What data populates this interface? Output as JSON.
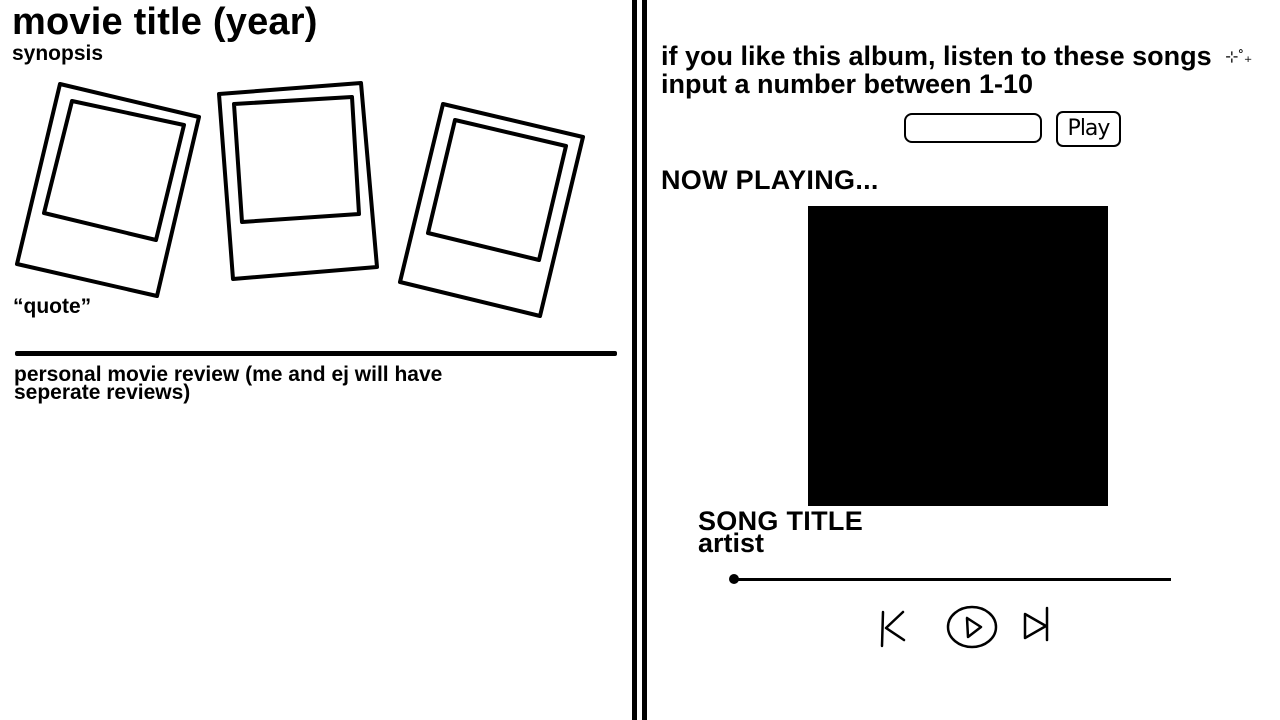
{
  "movie": {
    "title": "movie title (year)",
    "synopsis": "synopsis",
    "quote": "“quote”",
    "review": "personal movie review (me and ej will have seperate reviews)"
  },
  "recommend": {
    "text_before": "if you like this album, listen to these songs",
    "sparkle": "⊹˚₊",
    "text_after": "input a number between 1-10",
    "input_value": "",
    "play_label": "Play"
  },
  "player": {
    "now_playing_label": "NOW PLAYING...",
    "song_title": "SONG TITLE",
    "artist": "artist",
    "progress": 0
  },
  "icons": {
    "polaroids": [
      "polaroid-frame-icon",
      "polaroid-frame-icon",
      "polaroid-frame-icon"
    ],
    "controls": [
      "skip-back-icon",
      "play-icon",
      "skip-forward-icon"
    ]
  },
  "colors": {
    "ink": "#000000",
    "background": "#ffffff"
  }
}
